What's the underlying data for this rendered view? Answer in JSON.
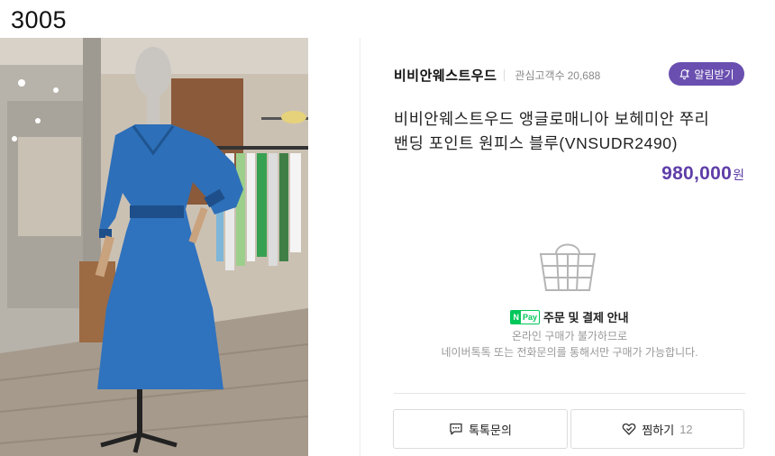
{
  "header": {
    "code": "3005"
  },
  "photo": {
    "description_icon": "product-photo"
  },
  "store": {
    "name": "비비안웨스트우드",
    "fans_label": "관심고객수",
    "fans_count": "20,688",
    "alarm_label": "알림받기"
  },
  "product": {
    "title_line1": "비비안웨스트우드 앵글로매니아 보헤미안 쭈리",
    "title_line2": "밴딩 포인트 원피스 블루(VNSUDR2490)",
    "price": "980,000",
    "currency": "원"
  },
  "payment": {
    "badge_n": "N",
    "badge_pay": "Pay",
    "title": "주문 및 결제 안내",
    "note_line1": "온라인 구매가 불가하므로",
    "note_line2": "네이버톡톡 또는 전화문의를 통해서만 구매가 가능합니다."
  },
  "actions": {
    "talk_label": "톡톡문의",
    "wish_label": "찜하기",
    "wish_count": "12"
  },
  "colors": {
    "accent": "#6a4fb0",
    "price": "#5f3ea8",
    "npay_green": "#03c75a"
  }
}
